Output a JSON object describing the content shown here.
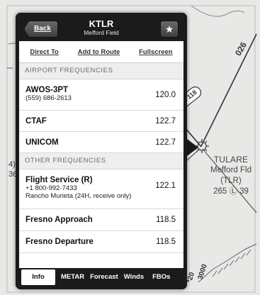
{
  "chart_labels": {
    "airport_name": "TULARE",
    "airport_field": "Mefford Fld",
    "airport_code": "(TLR)",
    "airport_info": "265 Ⓛ 39",
    "route_026": "026",
    "route_v118": "V 118",
    "alt_3000": "3000",
    "alt_20": "*20",
    "edge_label_a": "4)",
    "edge_label_b": "36"
  },
  "header": {
    "back_label": "Back",
    "title": "KTLR",
    "subtitle": "Mefford Field",
    "favorite_glyph": "★"
  },
  "actions": {
    "direct_to": "Direct To",
    "add_to_route": "Add to Route",
    "fullscreen": "Fullscreen"
  },
  "airport_frequencies": {
    "header": "AIRPORT FREQUENCIES",
    "rows": [
      {
        "name": "AWOS-3PT",
        "detail": "(559) 686-2613",
        "value": "120.0"
      },
      {
        "name": "CTAF",
        "value": "122.7"
      },
      {
        "name": "UNICOM",
        "value": "122.7"
      }
    ]
  },
  "other_frequencies": {
    "header": "OTHER FREQUENCIES",
    "rows": [
      {
        "name": "Flight Service (R)",
        "detail": "+1 800-992-7433",
        "detail2": "Rancho Murieta (24H, receive only)",
        "value": "122.1"
      },
      {
        "name": "Fresno Approach",
        "value": "118.5"
      },
      {
        "name": "Fresno Departure",
        "value": "118.5"
      }
    ]
  },
  "tabs": {
    "info": "Info",
    "metar": "METAR",
    "forecast": "Forecast",
    "winds": "Winds",
    "fbos": "FBOs"
  }
}
